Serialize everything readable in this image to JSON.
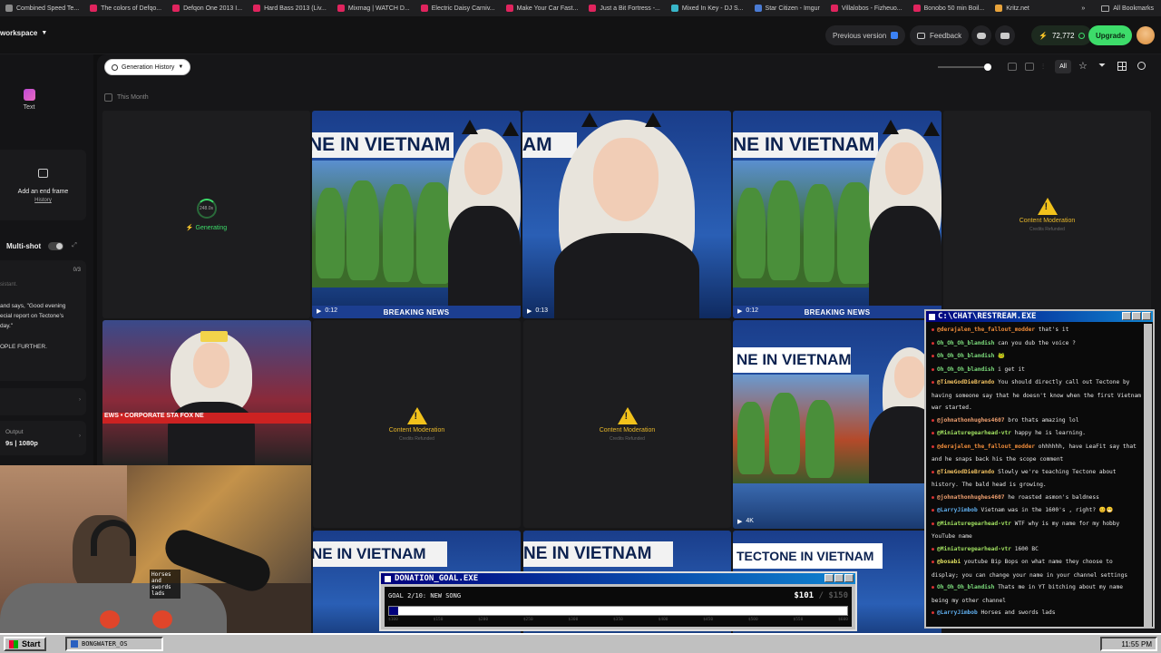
{
  "bookmarks": {
    "items": [
      {
        "label": "Combined Speed Te...",
        "color": "#8a8a8a"
      },
      {
        "label": "The colors of Defqo...",
        "color": "#e0245e"
      },
      {
        "label": "Defqon One 2013 I...",
        "color": "#e0245e"
      },
      {
        "label": "Hard Bass 2013 (Liv...",
        "color": "#e0245e"
      },
      {
        "label": "Mixmag | WATCH D...",
        "color": "#e0245e"
      },
      {
        "label": "Electric Daisy Carniv...",
        "color": "#e0245e"
      },
      {
        "label": "Make Your Car Fast...",
        "color": "#e0245e"
      },
      {
        "label": "Just a Bit Fortress -...",
        "color": "#e0245e"
      },
      {
        "label": "Mixed In Key - DJ S...",
        "color": "#38b6c9"
      },
      {
        "label": "Star Citizen - Imgur",
        "color": "#4a7bd4"
      },
      {
        "label": "Villalobos - Fizheuo...",
        "color": "#e0245e"
      },
      {
        "label": "Bonobo 50 min Boil...",
        "color": "#e0245e"
      },
      {
        "label": "Kritz.net",
        "color": "#e8a33b"
      }
    ],
    "overflow": "»",
    "all_bookmarks": "All Bookmarks"
  },
  "nav": {
    "workspace": "workspace",
    "previous_version": "Previous version",
    "feedback": "Feedback",
    "credits": "72,772",
    "upgrade": "Upgrade"
  },
  "sidebar": {
    "text_label": "Text",
    "end_frame": "Add an end frame",
    "history": "History",
    "multishot": "Multi-shot",
    "counter": "0/3",
    "prompt_hint": "sistant.",
    "prompt_line1": "and says, \"Good evening",
    "prompt_line2": "ecial report on Tectone's",
    "prompt_line3": "day.\"",
    "prompt_line4": "OPLE FURTHER.",
    "output_label": "Output",
    "output_value": "9s | 1080p"
  },
  "toolbar": {
    "generation_history": "Generation History",
    "this_month": "This Month",
    "filter_all": "All"
  },
  "tiles": {
    "generating_time": "248.0s",
    "generating_label": "Generating",
    "moderation_title": "Content Moderation",
    "moderation_sub": "Credits Refunded",
    "headline": "NE IN VIETNAM",
    "headline_alt": "TECTONE IN VIETNAM",
    "ticker": "BREAKING NEWS",
    "dur1": "0:12",
    "dur2": "0:13",
    "dur3": "0:12",
    "res": "4K",
    "fox_ticker": "EWS • CORPORATE STA    FOX NE"
  },
  "chat": {
    "title": "C:\\CHAT\\RESTREAM.EXE",
    "messages": [
      {
        "user": "@derajalen_the_fallout_modder",
        "text": "that's it",
        "color": "#f08c3a"
      },
      {
        "user": "Oh_Oh_Oh_blandish",
        "text": "can you dub the voice ?",
        "color": "#7ee07e"
      },
      {
        "user": "Oh_Oh_Oh_blandish",
        "text": "🐸",
        "color": "#7ee07e"
      },
      {
        "user": "Oh_Oh_Oh_blandish",
        "text": "i get it",
        "color": "#7ee07e"
      },
      {
        "user": "@TimeGodDieBrando",
        "text": "You should directly call out Tectone by having someone say that he doesn't know when the first Vietnam war started.",
        "color": "#f0c060"
      },
      {
        "user": "@johnathonhughes4607",
        "text": "bro thats amazing lol",
        "color": "#f0a070"
      },
      {
        "user": "@Miniaturegearhead-vtr",
        "text": "happy he is learning.",
        "color": "#a0e060"
      },
      {
        "user": "@derajalen_the_fallout_modder",
        "text": "ohhhhhh, have LeaFit say that and he snaps back his the scope comment",
        "color": "#f08c3a"
      },
      {
        "user": "@TimeGodDieBrando",
        "text": "Slowly we're teaching Tectone about history. The bald head is growing.",
        "color": "#f0c060"
      },
      {
        "user": "@johnathonhughes4607",
        "text": "he roasted asmon's baldness",
        "color": "#f0a070"
      },
      {
        "user": "@LarryJimbob",
        "text": "Vietnam was in the 1600's , right? 😊😁",
        "color": "#60b0f0"
      },
      {
        "user": "@Miniaturegearhead-vtr",
        "text": "WTF why is my name for my hobby YouTube name",
        "color": "#a0e060"
      },
      {
        "user": "@Miniaturegearhead-vtr",
        "text": "1600 BC",
        "color": "#a0e060"
      },
      {
        "user": "@bosabi",
        "text": "youtube Bip Bops on what name they choose to display; you can change your name in your channel settings",
        "color": "#e0e060"
      },
      {
        "user": "Oh_Oh_Oh_blandish",
        "text": "Thats me in YT bitching about my name being my other channel",
        "color": "#7ee07e"
      },
      {
        "user": "@LarryJimbob",
        "text": "Horses and swords lads",
        "color": "#60b0f0"
      }
    ]
  },
  "donation": {
    "title": "DONATION_GOAL.EXE",
    "goal": "GOAL 2/10: NEW SONG",
    "amount": "$101",
    "target": "/ $150",
    "progress": 0.02,
    "ticks": [
      "$100",
      "$150",
      "$200",
      "$250",
      "$300",
      "$350",
      "$400",
      "$450",
      "$500",
      "$550",
      "$600"
    ]
  },
  "webcam": {
    "overlay_text": "Horses and swords lads"
  },
  "taskbar": {
    "start": "Start",
    "app": "BONGWATER_OS",
    "clock": "11:55 PM"
  },
  "colors": {
    "accent_green": "#3ddc6a",
    "warning_yellow": "#f2c21b",
    "win_blue": "#00007c"
  }
}
